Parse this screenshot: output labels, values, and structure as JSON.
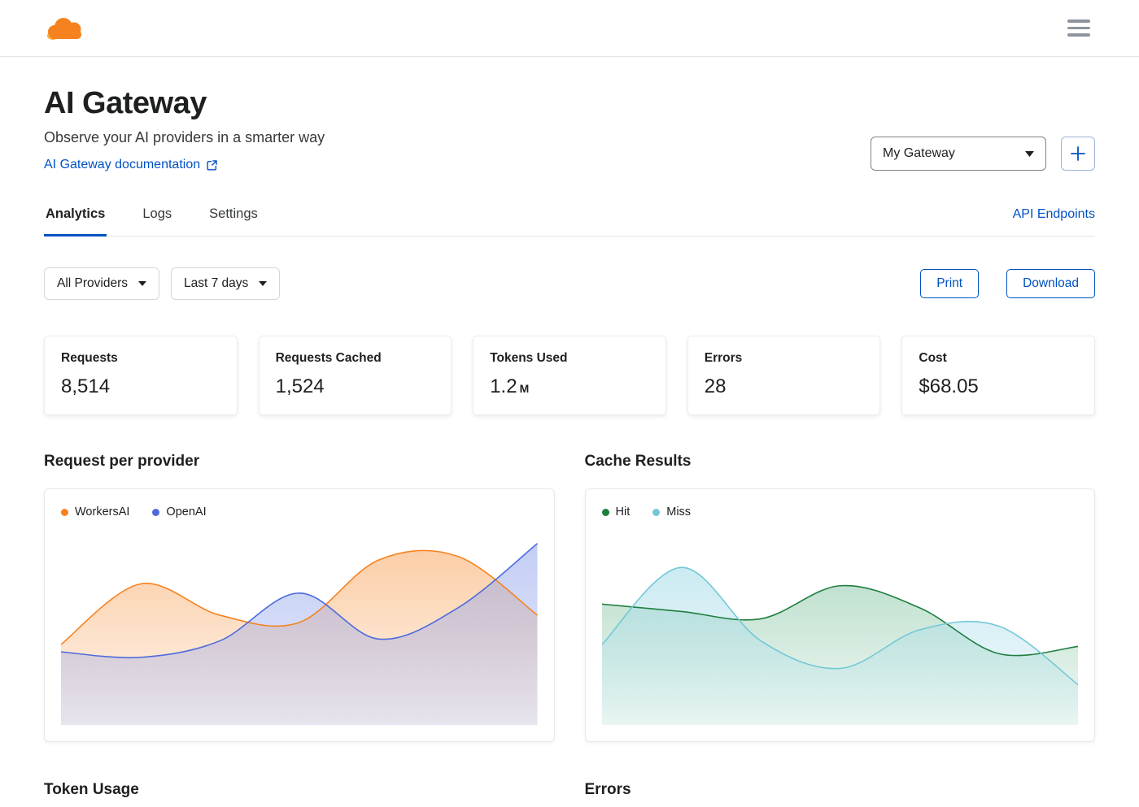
{
  "header": {
    "logo_name": "Cloudflare",
    "menu_icon": "hamburger-menu"
  },
  "page": {
    "title": "AI Gateway",
    "subtitle": "Observe your AI providers in a smarter way",
    "doc_link_label": "AI Gateway documentation",
    "gateway_selected": "My Gateway"
  },
  "tabs": {
    "items": [
      {
        "label": "Analytics",
        "active": true
      },
      {
        "label": "Logs",
        "active": false
      },
      {
        "label": "Settings",
        "active": false
      }
    ],
    "api_endpoints_label": "API Endpoints"
  },
  "filters": {
    "provider_filter": "All Providers",
    "date_filter": "Last 7 days",
    "print_label": "Print",
    "download_label": "Download"
  },
  "stats": [
    {
      "label": "Requests",
      "value": "8,514",
      "suffix": ""
    },
    {
      "label": "Requests Cached",
      "value": "1,524",
      "suffix": ""
    },
    {
      "label": "Tokens Used",
      "value": "1.2",
      "suffix": "M"
    },
    {
      "label": "Errors",
      "value": "28",
      "suffix": ""
    },
    {
      "label": "Cost",
      "value": "$68.05",
      "suffix": ""
    }
  ],
  "sections": {
    "chart1_title": "Request per provider",
    "chart2_title": "Cache Results",
    "bottom1_title": "Token Usage",
    "bottom2_title": "Errors"
  },
  "colors": {
    "accent_blue": "#0051c3",
    "brand_orange": "#f6821f"
  },
  "chart_data": [
    {
      "type": "area",
      "title": "Request per provider",
      "x": [
        1,
        2,
        3,
        4,
        5,
        6,
        7
      ],
      "ylim": [
        0,
        100
      ],
      "axes_hidden": true,
      "grid": false,
      "legend_position": "top-left",
      "series": [
        {
          "name": "WorkersAI",
          "color": "#f6821f",
          "fill": "#f8a55e",
          "fill_opacity_top": 0.55,
          "fill_opacity_bottom": 0.1,
          "values": [
            42,
            75,
            58,
            54,
            88,
            90,
            58
          ]
        },
        {
          "name": "OpenAI",
          "color": "#4d6bdd",
          "fill": "#93a5ec",
          "fill_opacity_top": 0.55,
          "fill_opacity_bottom": 0.22,
          "values": [
            38,
            35,
            44,
            70,
            45,
            62,
            97
          ]
        }
      ]
    },
    {
      "type": "area",
      "title": "Cache Results",
      "x": [
        1,
        2,
        3,
        4,
        5,
        6,
        7
      ],
      "ylim": [
        0,
        100
      ],
      "axes_hidden": true,
      "grid": false,
      "legend_position": "top-left",
      "series": [
        {
          "name": "Hit",
          "color": "#1e7e3e",
          "fill": "#74bd96",
          "fill_opacity_top": 0.45,
          "fill_opacity_bottom": 0.1,
          "values": [
            64,
            60,
            56,
            74,
            62,
            37,
            41
          ]
        },
        {
          "name": "Miss",
          "color": "#74c7d8",
          "fill": "#a8dde9",
          "fill_opacity_top": 0.6,
          "fill_opacity_bottom": 0.12,
          "values": [
            42,
            84,
            44,
            29,
            50,
            52,
            20
          ]
        }
      ]
    }
  ]
}
